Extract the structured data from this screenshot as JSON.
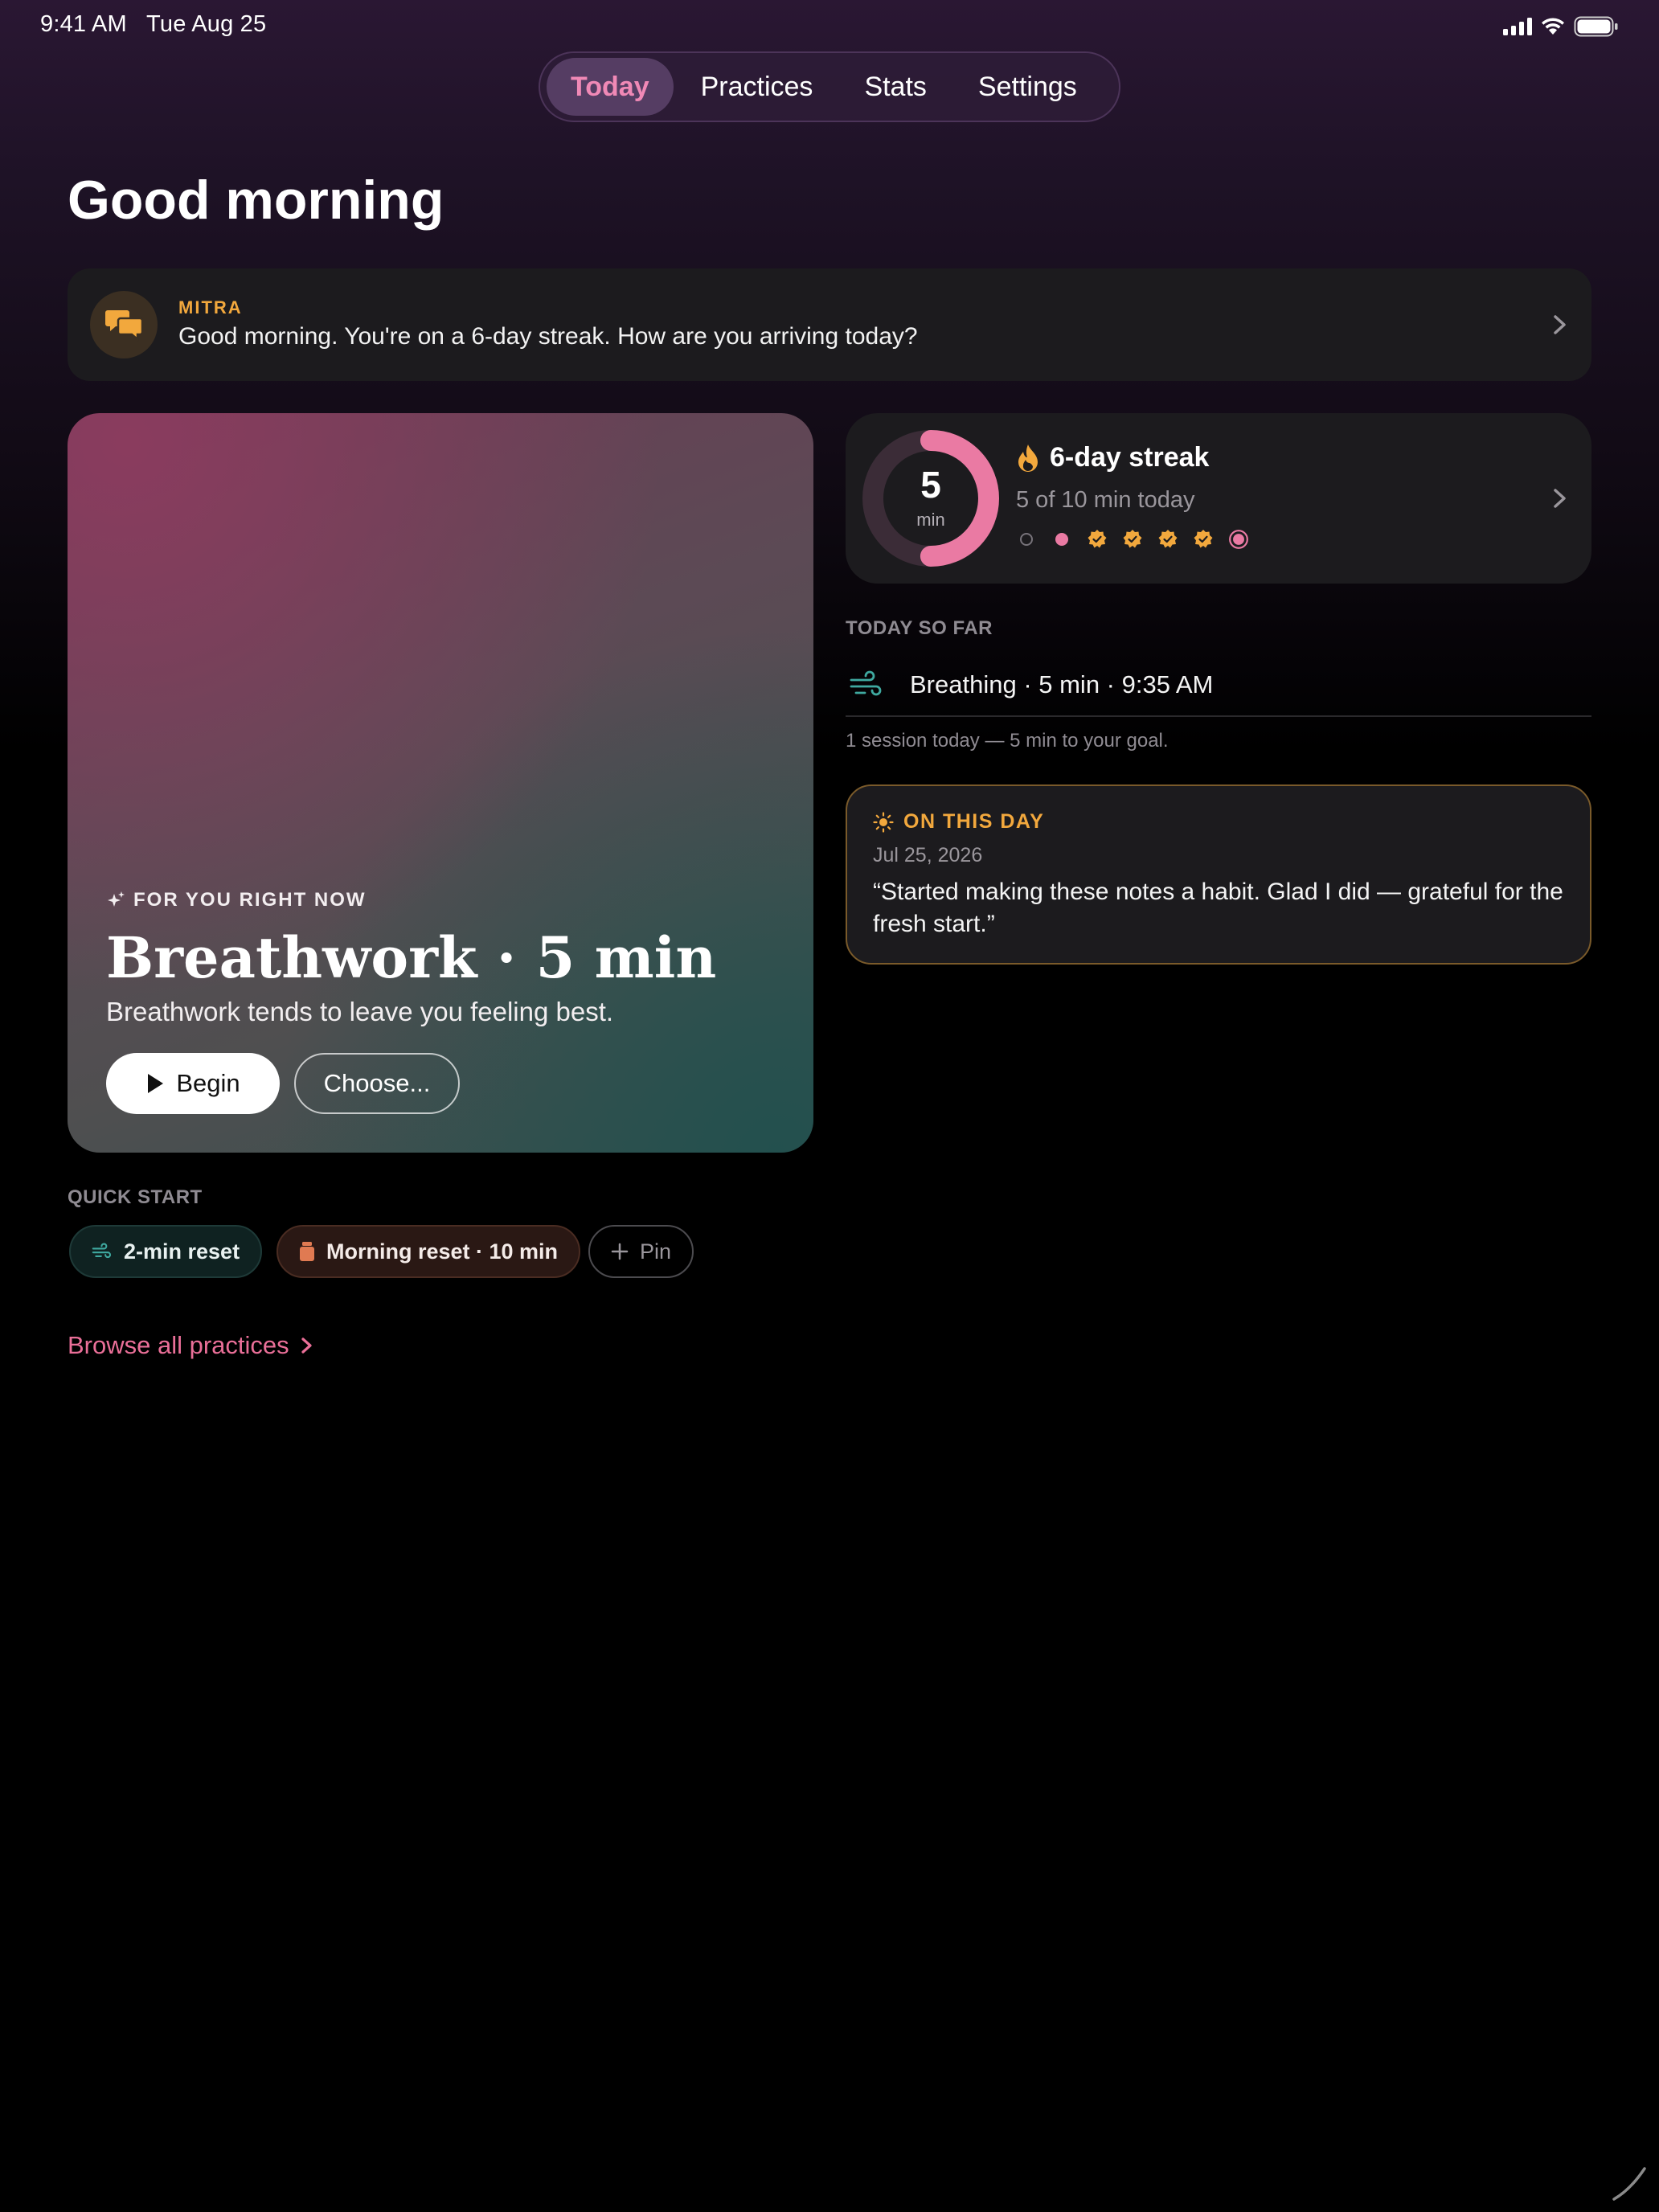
{
  "status_bar": {
    "time_date": "9:41 AM   Tue Aug 25"
  },
  "tabs": [
    {
      "label": "Today",
      "active": true
    },
    {
      "label": "Practices",
      "active": false
    },
    {
      "label": "Stats",
      "active": false
    },
    {
      "label": "Settings",
      "active": false
    }
  ],
  "page": {
    "title": "Good morning"
  },
  "mitra": {
    "label": "MITRA",
    "message": "Good morning. You're on a 6-day streak. How are you arriving today?",
    "icon": "chat-bubbles-icon"
  },
  "hero": {
    "kicker": "FOR YOU RIGHT NOW",
    "title": "Breathwork · 5 min",
    "subtitle": "Breathwork tends to leave you feeling best.",
    "begin_label": "Begin",
    "choose_label": "Choose..."
  },
  "streak": {
    "ring_value": "5",
    "ring_unit": "min",
    "progress_minutes": 5,
    "goal_minutes": 10,
    "title": "6-day streak",
    "subtitle": "5 of 10 min today",
    "days": [
      "empty",
      "dot",
      "check",
      "check",
      "check",
      "check",
      "today"
    ]
  },
  "today_so_far": {
    "label": "TODAY SO FAR",
    "session": "Breathing · 5 min · 9:35 AM",
    "summary": "1 session today — 5 min to your goal."
  },
  "on_this_day": {
    "label": "ON THIS DAY",
    "date": "Jul 25, 2026",
    "quote": "“Started making these notes a habit. Glad I did — grateful for the fresh start.”"
  },
  "quick_start": {
    "label": "QUICK START",
    "chips": [
      "2-min reset",
      "Morning reset · 10 min",
      "Pin"
    ]
  },
  "browse": {
    "label": "Browse all practices"
  },
  "colors": {
    "accent_pink": "#f089b6",
    "accent_orange": "#f2a83d",
    "card_bg": "#1c1b1e",
    "link_pink": "#ea6f98",
    "teal": "#3fa9a0"
  }
}
